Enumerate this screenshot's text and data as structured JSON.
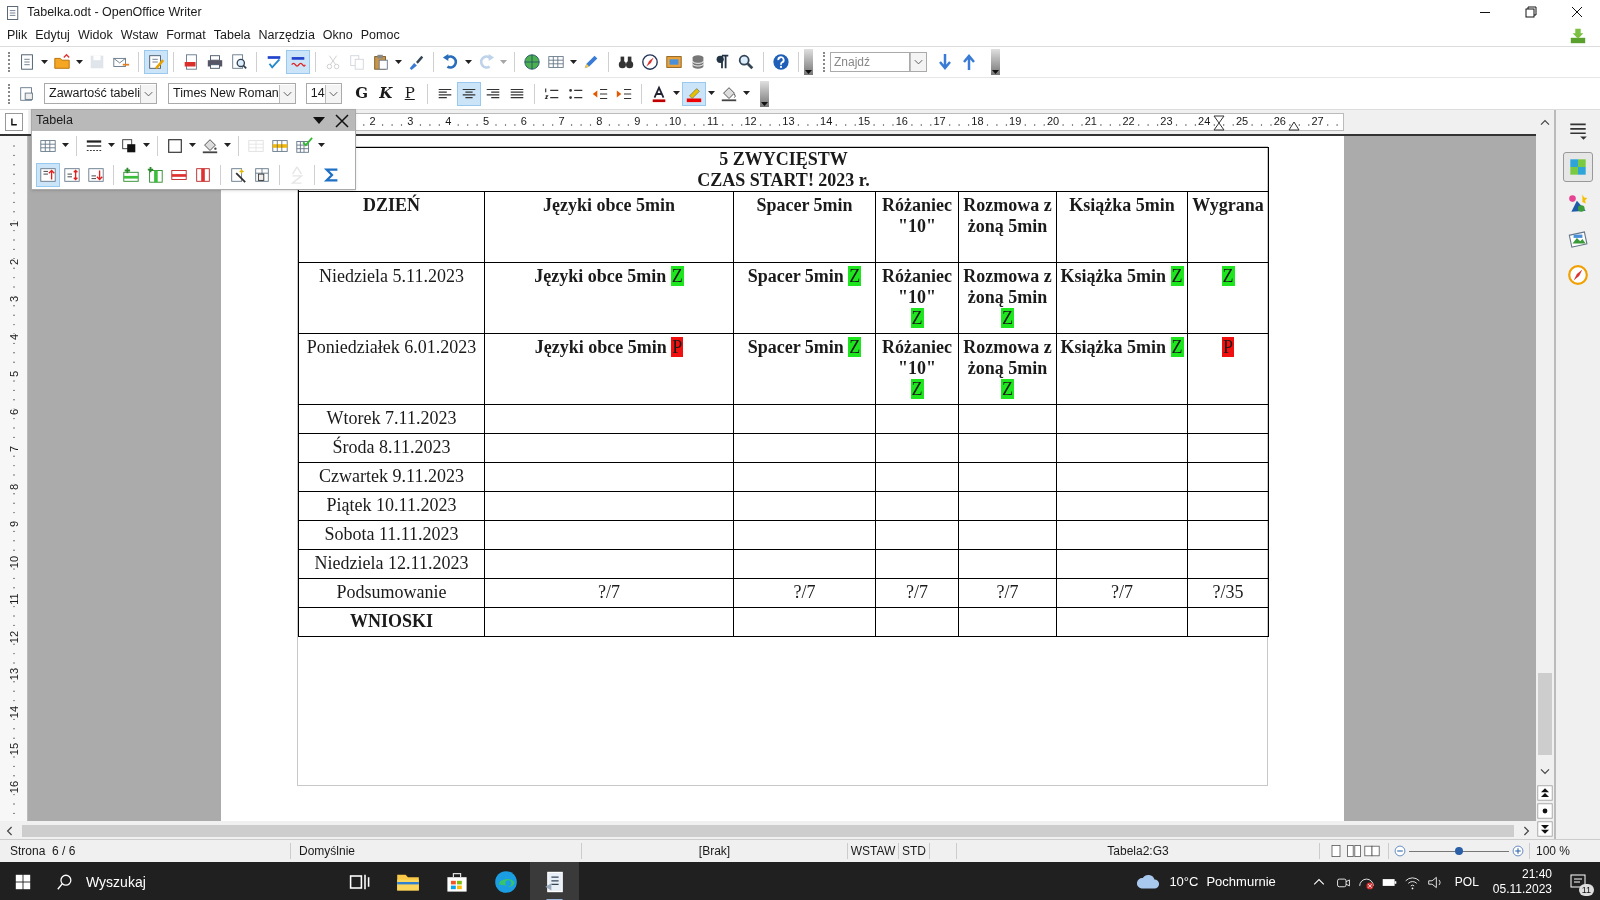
{
  "window": {
    "title": "Tabelka.odt - OpenOffice Writer"
  },
  "menu": [
    {
      "label": "Plik"
    },
    {
      "label": "Edytuj"
    },
    {
      "label": "Widok"
    },
    {
      "label": "Wstaw"
    },
    {
      "label": "Format"
    },
    {
      "label": "Tabela"
    },
    {
      "label": "Narzędzia"
    },
    {
      "label": "Okno"
    },
    {
      "label": "Pomoc"
    }
  ],
  "standard_toolbar": [
    [
      {
        "kind": "new",
        "dropdown": true,
        "selected": false,
        "disabled": false
      },
      {
        "kind": "open",
        "dropdown": true,
        "selected": false,
        "disabled": false
      },
      {
        "kind": "save",
        "dropdown": false,
        "selected": false,
        "disabled": true
      },
      {
        "kind": "email",
        "dropdown": false,
        "selected": false,
        "disabled": false
      }
    ],
    [
      {
        "kind": "edit",
        "dropdown": false,
        "selected": true,
        "disabled": false
      }
    ],
    [
      {
        "kind": "pdf",
        "dropdown": false,
        "selected": false,
        "disabled": false
      },
      {
        "kind": "print",
        "dropdown": false,
        "selected": false,
        "disabled": false
      },
      {
        "kind": "preview",
        "dropdown": false,
        "selected": false,
        "disabled": false
      }
    ],
    [
      {
        "kind": "spell",
        "dropdown": false,
        "selected": false,
        "disabled": false
      },
      {
        "kind": "autospell",
        "dropdown": false,
        "selected": true,
        "disabled": false
      }
    ],
    [
      {
        "kind": "cut",
        "dropdown": false,
        "selected": false,
        "disabled": true
      },
      {
        "kind": "copy",
        "dropdown": false,
        "selected": false,
        "disabled": true
      },
      {
        "kind": "paste",
        "dropdown": true,
        "selected": false,
        "disabled": false
      },
      {
        "kind": "brush",
        "dropdown": false,
        "selected": false,
        "disabled": false
      }
    ],
    [
      {
        "kind": "undo",
        "dropdown": true,
        "selected": false,
        "disabled": false
      },
      {
        "kind": "redo",
        "dropdown": true,
        "selected": false,
        "disabled": true
      }
    ],
    [
      {
        "kind": "globe",
        "dropdown": false,
        "selected": false,
        "disabled": false
      },
      {
        "kind": "table",
        "dropdown": true,
        "selected": false,
        "disabled": false
      },
      {
        "kind": "pencil",
        "dropdown": false,
        "selected": false,
        "disabled": false
      }
    ],
    [
      {
        "kind": "binoculars",
        "dropdown": false,
        "selected": false,
        "disabled": false
      },
      {
        "kind": "compass",
        "dropdown": false,
        "selected": false,
        "disabled": false
      },
      {
        "kind": "gallery",
        "dropdown": false,
        "selected": false,
        "disabled": false
      },
      {
        "kind": "database",
        "dropdown": false,
        "selected": false,
        "disabled": false
      },
      {
        "kind": "pilcrow",
        "dropdown": false,
        "selected": false,
        "disabled": false
      },
      {
        "kind": "zoom",
        "dropdown": false,
        "selected": false,
        "disabled": false
      }
    ],
    [
      {
        "kind": "help",
        "dropdown": false,
        "selected": false,
        "disabled": false
      }
    ]
  ],
  "find_toolbar": {
    "placeholder": "Znajdź"
  },
  "formatting_toolbar": {
    "paragraph_style": "Zawartość tabeli",
    "font_name": "Times New Roman",
    "font_size": "14",
    "text_buttons": [
      {
        "kind": "bold",
        "label": "G",
        "selected": false
      },
      {
        "kind": "italic",
        "label": "K",
        "selected": false
      },
      {
        "kind": "underline",
        "label": "P",
        "selected": false
      }
    ],
    "groups": [
      [
        {
          "kind": "alignleft",
          "dropdown": false,
          "selected": false,
          "disabled": false
        },
        {
          "kind": "aligncenter",
          "dropdown": false,
          "selected": true,
          "disabled": false
        },
        {
          "kind": "alignright",
          "dropdown": false,
          "selected": false,
          "disabled": false
        },
        {
          "kind": "justify",
          "dropdown": false,
          "selected": false,
          "disabled": false
        }
      ],
      [
        {
          "kind": "numbering",
          "dropdown": false,
          "selected": false,
          "disabled": false
        },
        {
          "kind": "bullets",
          "dropdown": false,
          "selected": false,
          "disabled": false
        },
        {
          "kind": "outdent",
          "dropdown": false,
          "selected": false,
          "disabled": false
        },
        {
          "kind": "indent",
          "dropdown": false,
          "selected": false,
          "disabled": false
        }
      ],
      [
        {
          "kind": "fontcolor",
          "dropdown": true,
          "selected": false,
          "disabled": false
        },
        {
          "kind": "highlight",
          "dropdown": true,
          "selected": true,
          "disabled": false
        },
        {
          "kind": "background",
          "dropdown": true,
          "selected": false,
          "disabled": false
        }
      ]
    ]
  },
  "table_toolbar": {
    "title": "Tabela",
    "rows": [
      [
        [
          {
            "kind": "table",
            "dropdown": true,
            "selected": false,
            "disabled": false
          }
        ],
        [
          {
            "kind": "linestyle",
            "dropdown": true,
            "selected": false,
            "disabled": false
          },
          {
            "kind": "bordercolor",
            "dropdown": true,
            "selected": false,
            "disabled": false
          }
        ],
        [
          {
            "kind": "borders",
            "dropdown": true,
            "selected": false,
            "disabled": false
          },
          {
            "kind": "bucket",
            "dropdown": true,
            "selected": false,
            "disabled": false
          }
        ],
        [
          {
            "kind": "merge",
            "dropdown": false,
            "selected": false,
            "disabled": true
          },
          {
            "kind": "split",
            "dropdown": false,
            "selected": false,
            "disabled": false
          },
          {
            "kind": "autoformat",
            "dropdown": true,
            "selected": false,
            "disabled": false
          }
        ]
      ],
      [
        [
          {
            "kind": "aligntop",
            "dropdown": false,
            "selected": true,
            "disabled": false
          },
          {
            "kind": "alignmiddle",
            "dropdown": false,
            "selected": false,
            "disabled": false
          },
          {
            "kind": "alignbottom",
            "dropdown": false,
            "selected": false,
            "disabled": false
          }
        ],
        [
          {
            "kind": "insertrow",
            "dropdown": false,
            "selected": false,
            "disabled": false
          },
          {
            "kind": "insertcol",
            "dropdown": false,
            "selected": false,
            "disabled": false
          },
          {
            "kind": "deleterow",
            "dropdown": false,
            "selected": false,
            "disabled": false
          },
          {
            "kind": "deletecol",
            "dropdown": false,
            "selected": false,
            "disabled": false
          }
        ],
        [
          {
            "kind": "wand",
            "dropdown": false,
            "selected": false,
            "disabled": false
          },
          {
            "kind": "tableprops",
            "dropdown": false,
            "selected": false,
            "disabled": false
          }
        ],
        [
          {
            "kind": "sort",
            "dropdown": false,
            "selected": false,
            "disabled": true
          }
        ],
        [
          {
            "kind": "sum",
            "dropdown": false,
            "selected": false,
            "disabled": false
          }
        ]
      ]
    ]
  },
  "ruler": {
    "horizontal": [
      "2",
      "3",
      "4",
      "5",
      "6",
      "7",
      "8",
      "9",
      "10",
      "11",
      "12",
      "13",
      "14",
      "15",
      "16",
      "17",
      "18",
      "19",
      "20",
      "21",
      "22",
      "23",
      "24",
      "25",
      "26",
      "27"
    ],
    "vertical": [
      "1",
      "2",
      "3",
      "4",
      "5",
      "6",
      "7",
      "8",
      "9",
      "10",
      "11",
      "12",
      "13",
      "14",
      "15",
      "16"
    ]
  },
  "document": {
    "title_lines": [
      "5 ZWYCIĘSTW",
      "CZAS START! 2023 r."
    ],
    "columns": [
      "DZIEŃ",
      "Języki obce 5min",
      "Spacer 5min",
      "Różaniec \"10\"",
      "Rozmowa z żoną 5min",
      "Książka 5min",
      "Wygrana"
    ],
    "rows": [
      {
        "kind": "day",
        "label": "Niedziela 5.11.2023",
        "cells": [
          {
            "text": "Języki obce 5min",
            "tag": "Z",
            "color": "#1ee61e"
          },
          {
            "text": "Spacer 5min",
            "tag": "Z",
            "color": "#1ee61e"
          },
          {
            "text": "Różaniec \"10\"",
            "tag": "Z",
            "color": "#1ee61e"
          },
          {
            "text": "Rozmowa z żoną 5min",
            "tag": "Z",
            "color": "#1ee61e"
          },
          {
            "text": "Książka 5min",
            "tag": "Z",
            "color": "#1ee61e"
          },
          {
            "tag": "Z",
            "color": "#1ee61e"
          }
        ]
      },
      {
        "kind": "day",
        "label": "Poniedziałek 6.01.2023",
        "cells": [
          {
            "text": "Języki obce 5min",
            "tag": "P",
            "color": "#f01010"
          },
          {
            "text": "Spacer 5min",
            "tag": "Z",
            "color": "#1ee61e"
          },
          {
            "text": "Różaniec \"10\"",
            "tag": "Z",
            "color": "#1ee61e"
          },
          {
            "text": "Rozmowa z żoną 5min",
            "tag": "Z",
            "color": "#1ee61e"
          },
          {
            "text": "Książka 5min",
            "tag": "Z",
            "color": "#1ee61e"
          },
          {
            "tag": "P",
            "color": "#f01010"
          }
        ]
      },
      {
        "kind": "day",
        "label": "Wtorek 7.11.2023"
      },
      {
        "kind": "day",
        "label": "Środa 8.11.2023"
      },
      {
        "kind": "day",
        "label": "Czwartek 9.11.2023"
      },
      {
        "kind": "day",
        "label": "Piątek 10.11.2023"
      },
      {
        "kind": "day",
        "label": "Sobota 11.11.2023"
      },
      {
        "kind": "day",
        "label": "Niedziela 12.11.2023"
      },
      {
        "kind": "summary",
        "label": "Podsumowanie",
        "cells": [
          {
            "text": "?/7"
          },
          {
            "text": "?/7"
          },
          {
            "text": "?/7"
          },
          {
            "text": "?/7"
          },
          {
            "text": "?/7"
          },
          {
            "text": "?/35"
          }
        ]
      },
      {
        "kind": "conclusion",
        "label": "WNIOSKI"
      }
    ]
  },
  "sidebar": [
    {
      "kind": "menu",
      "selected": false
    },
    {
      "kind": "properties",
      "selected": true
    },
    {
      "kind": "styles",
      "selected": false
    },
    {
      "kind": "gallery",
      "selected": false
    },
    {
      "kind": "navigator",
      "selected": false
    }
  ],
  "status_bar": {
    "page": "Strona  6 / 6",
    "page_style": "Domyślnie",
    "language": "[Brak]",
    "insert_mode": "WSTAW",
    "selection_mode": "STD",
    "cell": "Tabela2:G3",
    "zoom_slider": {
      "level": 0.5
    },
    "zoom": "100 %"
  },
  "taskbar": {
    "search_placeholder": "Wyszukaj",
    "apps": [
      {
        "kind": "taskview",
        "selected": false
      },
      {
        "kind": "folder",
        "selected": false
      },
      {
        "kind": "store",
        "selected": false
      },
      {
        "kind": "browser",
        "selected": false
      },
      {
        "kind": "writer",
        "selected": true
      }
    ],
    "temperature": "10°C",
    "weather": "Pochmurnie",
    "language": "POL",
    "time": "21:40",
    "date": "05.11.2023",
    "notifications": "11"
  }
}
